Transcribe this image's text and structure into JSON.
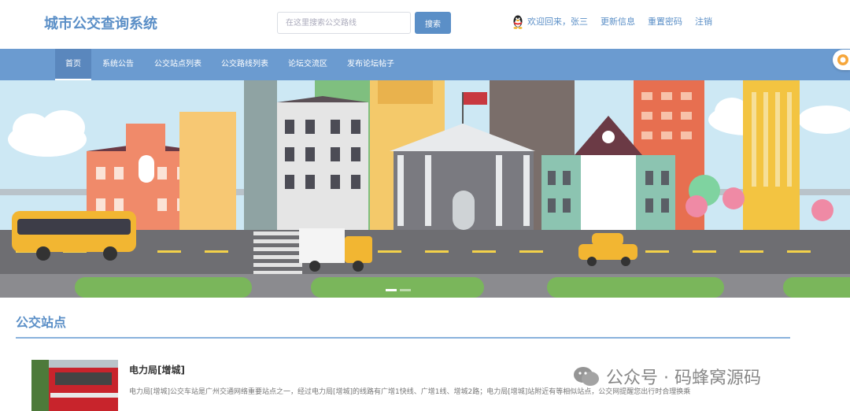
{
  "header": {
    "site_title": "城市公交查询系统",
    "search_placeholder": "在这里搜索公交路线",
    "search_button": "搜索",
    "welcome": "欢迎回来，张三",
    "links": [
      "更新信息",
      "重置密码",
      "注销"
    ]
  },
  "nav": {
    "items": [
      "首页",
      "系统公告",
      "公交站点列表",
      "公交路线列表",
      "论坛交流区",
      "发布论坛帖子"
    ],
    "active_index": 0
  },
  "section": {
    "title": "公交站点"
  },
  "station": {
    "name": "电力局[增城]",
    "description": "电力局[增城]公交车站是广州交通网络重要站点之一，经过电力局[增城]的线路有广增1快线、广增1线、增城2路；电力局[增城]站附近有等相似站点，公交网提醒您出行时合理换乘"
  },
  "watermark": {
    "text": "公众号 · 码蜂窝源码"
  },
  "colors": {
    "primary": "#5b8fc7",
    "nav_bg": "#6b9bd0",
    "sky": "#cde8f4"
  }
}
